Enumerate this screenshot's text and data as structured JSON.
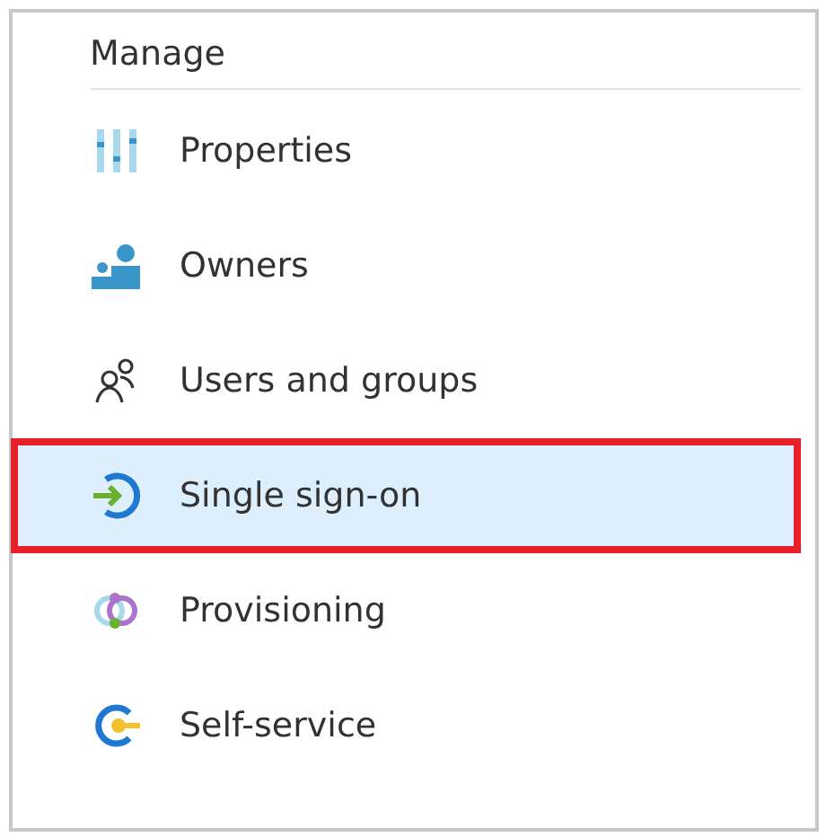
{
  "section": {
    "title": "Manage"
  },
  "items": [
    {
      "label": "Properties",
      "selected": false
    },
    {
      "label": "Owners",
      "selected": false
    },
    {
      "label": "Users and groups",
      "selected": false
    },
    {
      "label": "Single sign-on",
      "selected": true
    },
    {
      "label": "Provisioning",
      "selected": false
    },
    {
      "label": "Self-service",
      "selected": false
    }
  ]
}
